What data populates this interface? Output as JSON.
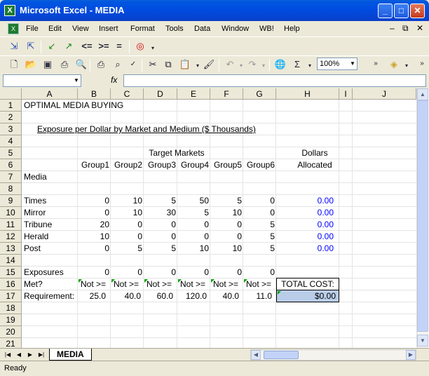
{
  "window": {
    "title": "Microsoft Excel - MEDIA",
    "icon": "excel-app-icon"
  },
  "menu": {
    "items": [
      "File",
      "Edit",
      "View",
      "Insert",
      "Format",
      "Tools",
      "Data",
      "Window",
      "WB!",
      "Help"
    ],
    "window_controls": [
      "_",
      "̸",
      "x"
    ]
  },
  "toolbar": {
    "zoom": "100%",
    "custom_buttons": [
      "<=",
      ">=",
      "="
    ]
  },
  "formula_bar": {
    "name_box": "",
    "fx_label": "fx",
    "formula": ""
  },
  "columns": [
    "A",
    "B",
    "C",
    "D",
    "E",
    "F",
    "G",
    "H",
    "I",
    "J"
  ],
  "rows": [
    "1",
    "2",
    "3",
    "4",
    "5",
    "6",
    "7",
    "8",
    "9",
    "10",
    "11",
    "12",
    "13",
    "14",
    "15",
    "16",
    "17",
    "18",
    "19",
    "20",
    "21"
  ],
  "sheet": {
    "title": "OPTIMAL MEDIA BUYING",
    "subtitle": "Exposure per Dollar by Market and Medium ($ Thousands)",
    "target_markets": "Target Markets",
    "dollars": "Dollars",
    "allocated": "Allocated",
    "media_label": "Media",
    "groups": [
      "Group1",
      "Group2",
      "Group3",
      "Group4",
      "Group5",
      "Group6"
    ],
    "media": [
      {
        "name": "Times",
        "values": [
          "0",
          "10",
          "5",
          "50",
          "5",
          "0"
        ],
        "allocated": "0.00"
      },
      {
        "name": "Mirror",
        "values": [
          "0",
          "10",
          "30",
          "5",
          "10",
          "0"
        ],
        "allocated": "0.00"
      },
      {
        "name": "Tribune",
        "values": [
          "20",
          "0",
          "0",
          "0",
          "0",
          "5"
        ],
        "allocated": "0.00"
      },
      {
        "name": "Herald",
        "values": [
          "10",
          "0",
          "0",
          "0",
          "0",
          "5"
        ],
        "allocated": "0.00"
      },
      {
        "name": "Post",
        "values": [
          "0",
          "5",
          "5",
          "10",
          "10",
          "5"
        ],
        "allocated": "0.00"
      }
    ],
    "exposures_label": "Exposures",
    "exposures": [
      "0",
      "0",
      "0",
      "0",
      "0",
      "0"
    ],
    "met_label": "Met?",
    "met": [
      "Not >=",
      "Not >=",
      "Not >=",
      "Not >=",
      "Not >=",
      "Not >="
    ],
    "requirement_label": "Requirement:",
    "requirements": [
      "25.0",
      "40.0",
      "60.0",
      "120.0",
      "40.0",
      "11.0"
    ],
    "total_cost_label": "TOTAL COST:",
    "total_cost": "$0.00"
  },
  "tabs": {
    "active": "MEDIA"
  },
  "status": {
    "text": "Ready"
  }
}
